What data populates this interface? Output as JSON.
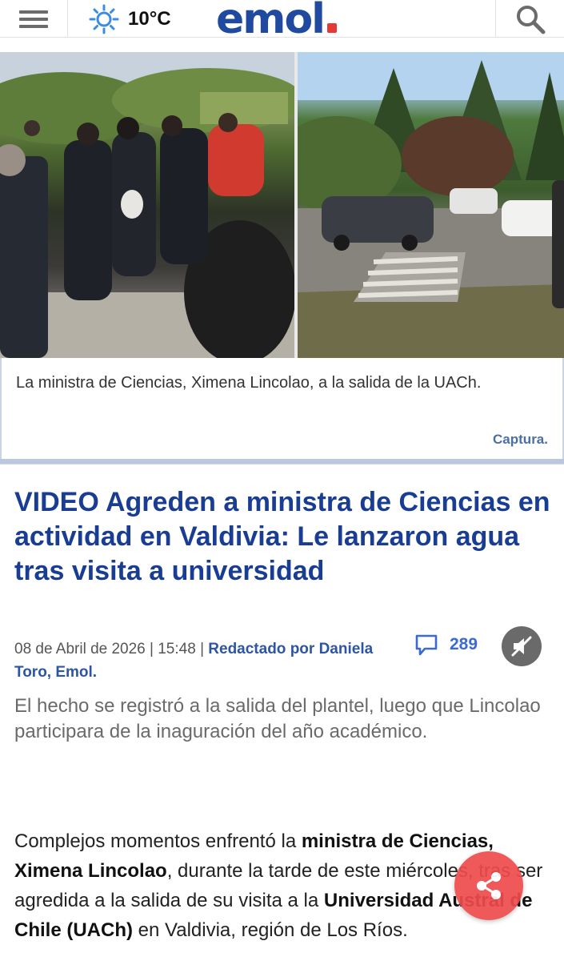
{
  "header": {
    "temperature": "10°C",
    "logo_text": "emol",
    "icons": [
      "menu-icon",
      "sun-icon",
      "search-icon"
    ]
  },
  "hero": {
    "caption": "La ministra de Ciencias, Ximena Lincolao, a la salida de la UACh.",
    "credit": "Captura."
  },
  "article": {
    "title": "VIDEO Agreden a ministra de Ciencias en actividad en Valdivia: Le lanzaron agua tras visita a universidad",
    "date": "08 de Abril de 2026 | 15:48 | ",
    "byline": "Redactado por Daniela Toro, Emol.",
    "comments_count": "289",
    "lead": "El hecho se registró a la salida del plantel, luego que Lincolao participara de la inaguración del año académico.",
    "body": {
      "p1_a": "Complejos momentos enfrentó la ",
      "p1_b": "ministra de Ciencias, Ximena Lincolao",
      "p1_c": ", durante la tarde de este miércoles, tras ser agredida a la salida de su visita a la ",
      "p1_d": "Universidad Austral de Chile (UACh)",
      "p1_e": " en Valdivia, región de Los Ríos."
    }
  },
  "colors": {
    "brand_blue": "#1a3d94",
    "brand_red": "#e53935",
    "link_blue": "#2e55a3",
    "share_red": "#ef4b4b"
  }
}
